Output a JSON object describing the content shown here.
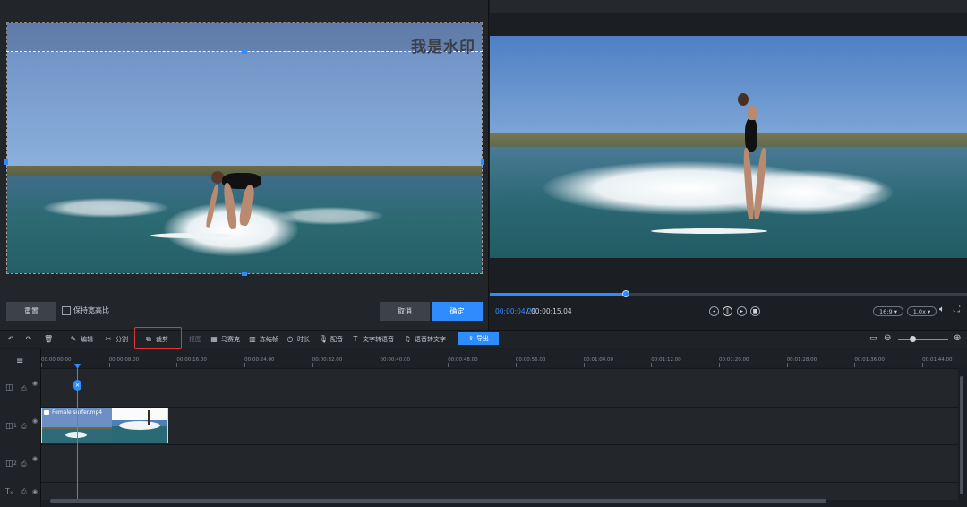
{
  "crop": {
    "watermark": "我是水印",
    "reset_label": "重置",
    "keep_ratio_label": "保持宽高比",
    "cancel_label": "取消",
    "confirm_label": "确定"
  },
  "player": {
    "current_time": "00:00:04.29",
    "separator": "/",
    "total_time": "00:00:15.04",
    "progress": 0.285,
    "aspect_ratio": "16:9",
    "speed": "1.0x"
  },
  "toolbar": {
    "edit": "编辑",
    "split": "分割",
    "crop": "裁剪",
    "freeze": "抠图",
    "mosaic": "马赛克",
    "freeze_frame": "冻结帧",
    "duration": "时长",
    "voiceover": "配音",
    "tts": "文字转语音",
    "stt": "语音转文字",
    "export": "导出"
  },
  "timeline": {
    "ticks": [
      "00:00:00.00",
      "00:00:08.00",
      "00:00:16.00",
      "00:00:24.00",
      "00:00:32.00",
      "00:00:40.00",
      "00:00:48.00",
      "00:00:56.00",
      "00:01:04.00",
      "00:01:12.00",
      "00:01:20.00",
      "00:01:28.00",
      "00:01:36.00",
      "00:01:44.00"
    ],
    "track_labels": [
      "1",
      "2"
    ],
    "clip_name": "Female surfer.mp4"
  },
  "colors": {
    "accent": "#2f8cff",
    "highlight": "#e0373a"
  }
}
